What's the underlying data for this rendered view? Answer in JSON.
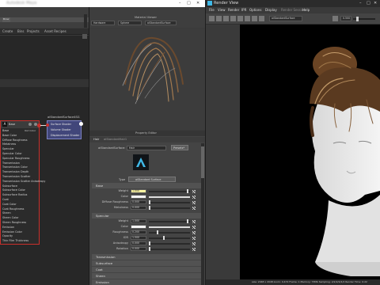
{
  "maya": {
    "title_blurred": "Autodesk Maya",
    "hypershade_tabs": [
      "Create",
      "Bins",
      "Projects",
      "Asset Recipes"
    ],
    "viewport_label": "Material Viewer",
    "viewport_dropdowns": [
      "Hardware",
      "Sphere",
      "aiStandardSurface"
    ],
    "shader_node": {
      "header": "Base",
      "ports": [
        "Base",
        "Base Color",
        "Diffuse Roughness",
        "Metalness",
        "Specular",
        "Specular Color",
        "Specular Roughness",
        "Transmission",
        "Transmission Color",
        "Transmission Depth",
        "Transmission Scatter",
        "Transmission Scatter Anisotropy",
        "Subsurface",
        "Subsurface Color",
        "Subsurface Radius",
        "Coat",
        "Coat Color",
        "Coat Roughness",
        "Sheen",
        "Sheen Color",
        "Sheen Roughness",
        "Emission",
        "Emission Color",
        "Opacity",
        "Thin Film Thickness"
      ],
      "out_label": "Out Color"
    },
    "sg_node": {
      "title": "aiStandardSurface4SG",
      "ports": [
        "Surface Shader",
        "Volume Shader",
        "Displacement Shader"
      ]
    },
    "attr_editor": {
      "header": "Property Editor",
      "tabs": [
        "Hair",
        "aiStandardHair1"
      ],
      "shader_type_label": "aiStandardSurface:",
      "shader_name": "Hair",
      "presets_label": "Presets*",
      "type_label": "Type",
      "type_value": "aiStandard Surface",
      "base_section": "Base",
      "base_rows": [
        {
          "label": "Weight",
          "value": "1.000",
          "slider": 0.95
        },
        {
          "label": "Color",
          "value": "",
          "swatch": "#f4f4f4"
        },
        {
          "label": "Diffuse Roughness",
          "value": "0.000",
          "slider": 0.0
        },
        {
          "label": "Metalness",
          "value": "0.000",
          "slider": 0.0
        }
      ],
      "specular_section": "Specular",
      "specular_rows": [
        {
          "label": "Weight",
          "value": "1.000",
          "slider": 0.95
        },
        {
          "label": "Color",
          "value": "",
          "swatch": "#f4f4f4"
        },
        {
          "label": "Roughness",
          "value": "0.200",
          "slider": 0.2
        },
        {
          "label": "IOR",
          "value": "1.500",
          "slider": 0.35
        },
        {
          "label": "Anisotropy",
          "value": "0.000",
          "slider": 0.0
        },
        {
          "label": "Rotation",
          "value": "0.000",
          "slider": 0.0
        }
      ],
      "collapsed_sections": [
        "Transmission",
        "Subsurface",
        "Coat",
        "Sheen",
        "Emission"
      ],
      "weight_field_color": "#fdf6a3"
    }
  },
  "render_view": {
    "title": "Render View",
    "menu": [
      "File",
      "View",
      "Render",
      "IPR",
      "Options",
      "Display",
      "Render Session",
      "Help"
    ],
    "camera_dropdown": "aiStandardSurface",
    "zoom_value": "0.500",
    "status_text": "size: 2048 x 2048  zoom: 0.472   Frame: 1    Memory: 73Mb    Sampling: 2/2/2/2/2/2    Render Time: 0:22"
  },
  "colors": {
    "node_border": "#c9302c",
    "sg_node": "#41467a",
    "hair_dark": "#4a2d18",
    "hair_light": "#b98a55"
  }
}
